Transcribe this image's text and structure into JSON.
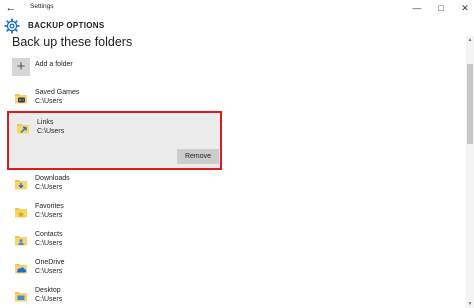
{
  "window": {
    "title": "Settings",
    "back_glyph": "←",
    "minimize_glyph": "—",
    "maximize_glyph": "□",
    "close_glyph": "✕"
  },
  "header": {
    "icon": "gear-icon",
    "title": "BACKUP OPTIONS",
    "accent_color": "#1f6fd6"
  },
  "page": {
    "title": "Back up these folders",
    "add_label": "Add a folder",
    "add_glyph": "+"
  },
  "folders": [
    {
      "name": "Saved Games",
      "path": "C:\\Users",
      "icon": "saved-games-folder-icon"
    },
    {
      "name": "Links",
      "path": "C:\\Users",
      "icon": "links-folder-icon",
      "selected": true
    },
    {
      "name": "Downloads",
      "path": "C:\\Users",
      "icon": "downloads-folder-icon"
    },
    {
      "name": "Favorites",
      "path": "C:\\Users",
      "icon": "favorites-folder-icon"
    },
    {
      "name": "Contacts",
      "path": "C:\\Users",
      "icon": "contacts-folder-icon"
    },
    {
      "name": "OneDrive",
      "path": "C:\\Users",
      "icon": "onedrive-folder-icon"
    },
    {
      "name": "Desktop",
      "path": "C:\\Users",
      "icon": "desktop-folder-icon"
    }
  ],
  "selected_panel": {
    "remove_label": "Remove",
    "highlight_color": "#e01b1b"
  },
  "scrollbar": {
    "up_glyph": "▲",
    "down_glyph": "▼"
  }
}
